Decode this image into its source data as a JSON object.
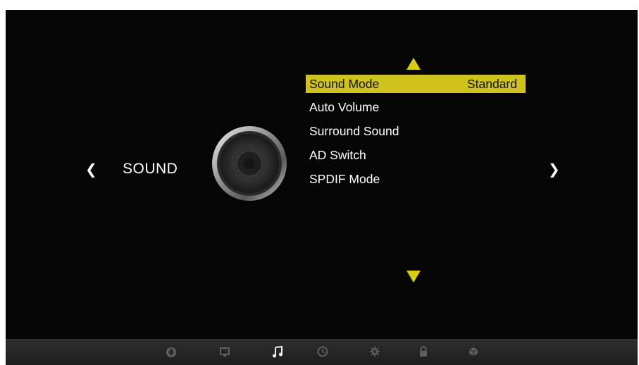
{
  "section": {
    "title": "SOUND",
    "prev_arrow": "❮",
    "next_arrow": "❯"
  },
  "menu": {
    "items": [
      {
        "label": "Sound Mode",
        "value": "Standard",
        "selected": true
      },
      {
        "label": "Auto Volume",
        "value": ""
      },
      {
        "label": "Surround Sound",
        "value": ""
      },
      {
        "label": "AD Switch",
        "value": ""
      },
      {
        "label": "SPDIF Mode",
        "value": ""
      }
    ]
  },
  "bottom_bar": {
    "icons": [
      "channel-icon",
      "picture-icon",
      "sound-icon",
      "time-icon",
      "setup-icon",
      "lock-icon",
      "input-icon"
    ],
    "active": "sound-icon"
  },
  "colors": {
    "accent": "#d8cf12",
    "selected_bg": "#cfc21b",
    "background": "#050505"
  }
}
